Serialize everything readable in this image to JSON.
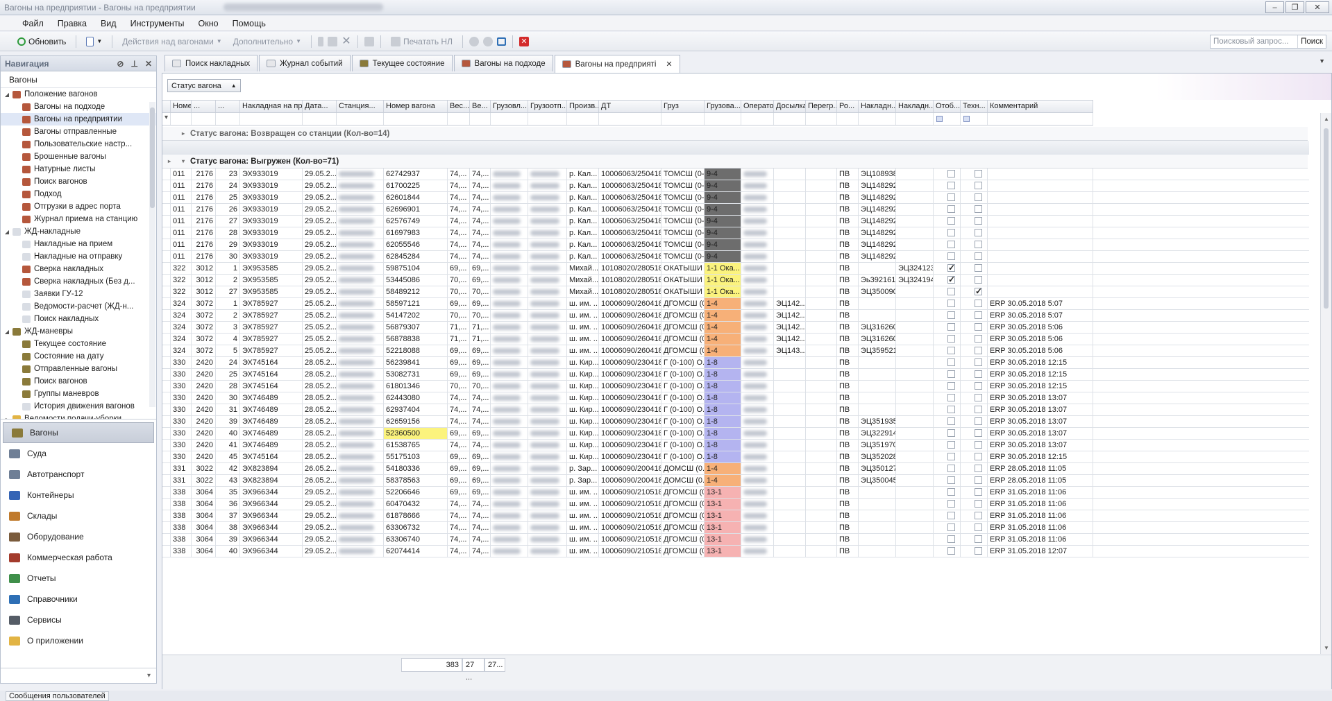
{
  "window": {
    "title": "Вагоны на предприятии - Вагоны на предприятии",
    "controls": [
      "‒",
      "❐",
      "✕"
    ]
  },
  "menu": [
    "Файл",
    "Правка",
    "Вид",
    "Инструменты",
    "Окно",
    "Помощь"
  ],
  "toolbar": {
    "refresh": "Обновить",
    "actions": "Действия над вагонами",
    "more": "Дополнительно",
    "print": "Печатать НЛ",
    "search_placeholder": "Поисковый запрос...",
    "search_button": "Поиск"
  },
  "nav": {
    "title": "Навигация",
    "section": "Вагоны",
    "tree": [
      {
        "label": "Положение вагонов",
        "level": 0,
        "expand": "◢",
        "icon": "#b5573c"
      },
      {
        "label": "Вагоны на подходе",
        "level": 1,
        "icon": "#b5573c"
      },
      {
        "label": "Вагоны на предприятии",
        "level": 1,
        "icon": "#b5573c",
        "selected": true
      },
      {
        "label": "Вагоны отправленные",
        "level": 1,
        "icon": "#b5573c"
      },
      {
        "label": "Пользовательские настр...",
        "level": 1,
        "icon": "#b5573c"
      },
      {
        "label": "Брошенные вагоны",
        "level": 1,
        "icon": "#b5573c"
      },
      {
        "label": "Натурные листы",
        "level": 1,
        "icon": "#b5573c"
      },
      {
        "label": "Поиск вагонов",
        "level": 1,
        "icon": "#b5573c"
      },
      {
        "label": "Подход",
        "level": 1,
        "icon": "#b5573c"
      },
      {
        "label": "Отгрузки в адрес порта",
        "level": 1,
        "icon": "#b5573c"
      },
      {
        "label": "Журнал приема на станцию",
        "level": 1,
        "icon": "#b5573c"
      },
      {
        "label": "ЖД-накладные",
        "level": 0,
        "expand": "◢",
        "icon": "#d9dde4"
      },
      {
        "label": "Накладные на прием",
        "level": 1,
        "icon": "#d9dde4"
      },
      {
        "label": "Накладные на отправку",
        "level": 1,
        "icon": "#d9dde4"
      },
      {
        "label": "Сверка накладных",
        "level": 1,
        "icon": "#b5573c"
      },
      {
        "label": "Сверка накладных (Без д...",
        "level": 1,
        "icon": "#b5573c"
      },
      {
        "label": "Заявки ГУ-12",
        "level": 1,
        "icon": "#d9dde4"
      },
      {
        "label": "Ведомости-расчет (ЖД-н...",
        "level": 1,
        "icon": "#d9dde4"
      },
      {
        "label": "Поиск накладных",
        "level": 1,
        "icon": "#d9dde4"
      },
      {
        "label": "ЖД-маневры",
        "level": 0,
        "expand": "◢",
        "icon": "#8a7a3a"
      },
      {
        "label": "Текущее состояние",
        "level": 1,
        "icon": "#8a7a3a"
      },
      {
        "label": "Состояние на дату",
        "level": 1,
        "icon": "#8a7a3a"
      },
      {
        "label": "Отправленные вагоны",
        "level": 1,
        "icon": "#8a7a3a"
      },
      {
        "label": "Поиск вагонов",
        "level": 1,
        "icon": "#8a7a3a"
      },
      {
        "label": "Группы маневров",
        "level": 1,
        "icon": "#8a7a3a"
      },
      {
        "label": "История движения вагонов",
        "level": 1,
        "icon": "#d9dde4"
      },
      {
        "label": "Ведомости подачи-уборки",
        "level": 0,
        "expand": "▸",
        "icon": "#e2b444"
      }
    ],
    "categories": [
      {
        "label": "Вагоны",
        "icon": "#8a7a3a",
        "selected": true
      },
      {
        "label": "Суда",
        "icon": "#6f7f96"
      },
      {
        "label": "Автотранспорт",
        "icon": "#6f7f96"
      },
      {
        "label": "Контейнеры",
        "icon": "#3564b5"
      },
      {
        "label": "Склады",
        "icon": "#c07a2c"
      },
      {
        "label": "Оборудование",
        "icon": "#7a5b3c"
      },
      {
        "label": "Коммерческая работа",
        "icon": "#a33b2c"
      },
      {
        "label": "Отчеты",
        "icon": "#3f8f4a"
      },
      {
        "label": "Справочники",
        "icon": "#2e6fb5"
      },
      {
        "label": "Сервисы",
        "icon": "#555c66"
      },
      {
        "label": "О приложении",
        "icon": "#e2b444"
      }
    ]
  },
  "tabs": [
    {
      "label": "Поиск накладных",
      "icon": "#e6e7ea"
    },
    {
      "label": "Журнал событий",
      "icon": "#e6e7ea"
    },
    {
      "label": "Текущее состояние",
      "icon": "#8a7a3a"
    },
    {
      "label": "Вагоны на подходе",
      "icon": "#b5573c"
    },
    {
      "label": "Вагоны на предприяті",
      "icon": "#b5573c",
      "active": true
    }
  ],
  "grid": {
    "group_button": "Статус вагона",
    "columns": [
      "Номер...",
      "...",
      "...",
      "Накладная на прием",
      "Дата...",
      "Станция...",
      "Номер вагона",
      "Вес...",
      "Ве...",
      "Грузовл...",
      "Грузоотп...",
      "Произв...",
      "ДТ",
      "Груз",
      "Грузова...",
      "Оператор",
      "Досылка",
      "Перегр...",
      "Ро...",
      "Накладн...",
      "Накладн...",
      "Отоб...",
      "Техн...",
      "Комментарий"
    ],
    "group1": "Статус вагона: Возвращен со станции (Кол-во=14)",
    "group2": "Статус вагона: Выгружен (Кол-во=71)",
    "rows": [
      [
        "011",
        "2176",
        "23",
        "ЭХ933019",
        "29.05.2...",
        "",
        "62742937",
        "74,...",
        "74,...",
        "",
        "",
        "р. Кал...",
        "10006063/250418...",
        "ТОМСШ (0-...",
        "9-4",
        "",
        "",
        "",
        "ПВ",
        "ЭЦ108938",
        "",
        false,
        false,
        ""
      ],
      [
        "011",
        "2176",
        "24",
        "ЭХ933019",
        "29.05.2...",
        "",
        "61700225",
        "74,...",
        "74,...",
        "",
        "",
        "р. Кал...",
        "10006063/250418...",
        "ТОМСШ (0-...",
        "9-4",
        "",
        "",
        "",
        "ПВ",
        "ЭЦ148292",
        "",
        false,
        false,
        ""
      ],
      [
        "011",
        "2176",
        "25",
        "ЭХ933019",
        "29.05.2...",
        "",
        "62601844",
        "74,...",
        "74,...",
        "",
        "",
        "р. Кал...",
        "10006063/250418...",
        "ТОМСШ (0-...",
        "9-4",
        "",
        "",
        "",
        "ПВ",
        "ЭЦ148292",
        "",
        false,
        false,
        ""
      ],
      [
        "011",
        "2176",
        "26",
        "ЭХ933019",
        "29.05.2...",
        "",
        "62696901",
        "74,...",
        "74,...",
        "",
        "",
        "р. Кал...",
        "10006063/250418...",
        "ТОМСШ (0-...",
        "9-4",
        "",
        "",
        "",
        "ПВ",
        "ЭЦ148292",
        "",
        false,
        false,
        ""
      ],
      [
        "011",
        "2176",
        "27",
        "ЭХ933019",
        "29.05.2...",
        "",
        "62576749",
        "74,...",
        "74,...",
        "",
        "",
        "р. Кал...",
        "10006063/250418...",
        "ТОМСШ (0-...",
        "9-4",
        "",
        "",
        "",
        "ПВ",
        "ЭЦ148292",
        "",
        false,
        false,
        ""
      ],
      [
        "011",
        "2176",
        "28",
        "ЭХ933019",
        "29.05.2...",
        "",
        "61697983",
        "74,...",
        "74,...",
        "",
        "",
        "р. Кал...",
        "10006063/250418...",
        "ТОМСШ (0-...",
        "9-4",
        "",
        "",
        "",
        "ПВ",
        "ЭЦ148292",
        "",
        false,
        false,
        ""
      ],
      [
        "011",
        "2176",
        "29",
        "ЭХ933019",
        "29.05.2...",
        "",
        "62055546",
        "74,...",
        "74,...",
        "",
        "",
        "р. Кал...",
        "10006063/250418...",
        "ТОМСШ (0-...",
        "9-4",
        "",
        "",
        "",
        "ПВ",
        "ЭЦ148292",
        "",
        false,
        false,
        ""
      ],
      [
        "011",
        "2176",
        "30",
        "ЭХ933019",
        "29.05.2...",
        "",
        "62845284",
        "74,...",
        "74,...",
        "",
        "",
        "р. Кал...",
        "10006063/250418...",
        "ТОМСШ (0-...",
        "9-4",
        "",
        "",
        "",
        "ПВ",
        "ЭЦ148292",
        "",
        false,
        false,
        ""
      ],
      [
        "322",
        "3012",
        "1",
        "ЭХ953585",
        "29.05.2...",
        "",
        "59875104",
        "69,...",
        "69,...",
        "",
        "",
        "Михай...",
        "10108020/280518...",
        "ОКАТЫШИ ...",
        "1-1 Ока...",
        "",
        "",
        "",
        "ПВ",
        "",
        "ЭЦ324123",
        true,
        false,
        ""
      ],
      [
        "322",
        "3012",
        "2",
        "ЭХ953585",
        "29.05.2...",
        "",
        "53445086",
        "70,...",
        "69,...",
        "",
        "",
        "Михай...",
        "10108020/280518...",
        "ОКАТЫШИ ...",
        "1-1 Ока...",
        "",
        "",
        "",
        "ПВ",
        "Эь392161",
        "ЭЦ324194",
        true,
        false,
        ""
      ],
      [
        "322",
        "3012",
        "27",
        "ЭХ953585",
        "29.05.2...",
        "",
        "58489212",
        "70,...",
        "70,...",
        "",
        "",
        "Михай...",
        "10108020/280518...",
        "ОКАТЫШИ ...",
        "1-1 Ока...",
        "",
        "",
        "",
        "ПВ",
        "ЭЦ350090",
        "",
        false,
        true,
        ""
      ],
      [
        "324",
        "3072",
        "1",
        "ЭХ785927",
        "25.05.2...",
        "",
        "58597121",
        "69,...",
        "69,...",
        "",
        "",
        "ш. им. ...",
        "10006090/260418...",
        "ДГОМСШ (0-...",
        "1-4",
        "",
        "ЭЦ142...",
        "",
        "ПВ",
        "",
        "",
        false,
        false,
        "ERP 30.05.2018 5:07"
      ],
      [
        "324",
        "3072",
        "2",
        "ЭХ785927",
        "25.05.2...",
        "",
        "54147202",
        "70,...",
        "70,...",
        "",
        "",
        "ш. им. ...",
        "10006090/260418...",
        "ДГОМСШ (0-...",
        "1-4",
        "",
        "ЭЦ142...",
        "",
        "ПВ",
        "",
        "",
        false,
        false,
        "ERP 30.05.2018 5:07"
      ],
      [
        "324",
        "3072",
        "3",
        "ЭХ785927",
        "25.05.2...",
        "",
        "56879307",
        "71,...",
        "71,...",
        "",
        "",
        "ш. им. ...",
        "10006090/260418...",
        "ДГОМСШ (0-...",
        "1-4",
        "",
        "ЭЦ142...",
        "",
        "ПВ",
        "ЭЦ316260",
        "",
        false,
        false,
        "ERP 30.05.2018 5:06"
      ],
      [
        "324",
        "3072",
        "4",
        "ЭХ785927",
        "25.05.2...",
        "",
        "56878838",
        "71,...",
        "71,...",
        "",
        "",
        "ш. им. ...",
        "10006090/260418...",
        "ДГОМСШ (0-...",
        "1-4",
        "",
        "ЭЦ142...",
        "",
        "ПВ",
        "ЭЦ316260",
        "",
        false,
        false,
        "ERP 30.05.2018 5:06"
      ],
      [
        "324",
        "3072",
        "5",
        "ЭХ785927",
        "25.05.2...",
        "",
        "52218088",
        "69,...",
        "69,...",
        "",
        "",
        "ш. им. ...",
        "10006090/260418...",
        "ДГОМСШ (0-...",
        "1-4",
        "",
        "ЭЦ143...",
        "",
        "ПВ",
        "ЭЦ359521",
        "",
        false,
        false,
        "ERP 30.05.2018 5:06"
      ],
      [
        "330",
        "2420",
        "24",
        "ЭХ745164",
        "28.05.2...",
        "",
        "56239841",
        "69,...",
        "69,...",
        "",
        "",
        "ш. Кир...",
        "10006090/230418...",
        "Г (0-100) О...",
        "1-8",
        "",
        "",
        "",
        "ПВ",
        "",
        "",
        false,
        false,
        "ERP 30.05.2018 12:15"
      ],
      [
        "330",
        "2420",
        "25",
        "ЭХ745164",
        "28.05.2...",
        "",
        "53082731",
        "69,...",
        "69,...",
        "",
        "",
        "ш. Кир...",
        "10006090/230418...",
        "Г (0-100) О...",
        "1-8",
        "",
        "",
        "",
        "ПВ",
        "",
        "",
        false,
        false,
        "ERP 30.05.2018 12:15"
      ],
      [
        "330",
        "2420",
        "28",
        "ЭХ745164",
        "28.05.2...",
        "",
        "61801346",
        "70,...",
        "70,...",
        "",
        "",
        "ш. Кир...",
        "10006090/230418...",
        "Г (0-100) О...",
        "1-8",
        "",
        "",
        "",
        "ПВ",
        "",
        "",
        false,
        false,
        "ERP 30.05.2018 12:15"
      ],
      [
        "330",
        "2420",
        "30",
        "ЭХ746489",
        "28.05.2...",
        "",
        "62443080",
        "74,...",
        "74,...",
        "",
        "",
        "ш. Кир...",
        "10006090/230418...",
        "Г (0-100) О...",
        "1-8",
        "",
        "",
        "",
        "ПВ",
        "",
        "",
        false,
        false,
        "ERP 30.05.2018 13:07"
      ],
      [
        "330",
        "2420",
        "31",
        "ЭХ746489",
        "28.05.2...",
        "",
        "62937404",
        "74,...",
        "74,...",
        "",
        "",
        "ш. Кир...",
        "10006090/230418...",
        "Г (0-100) О...",
        "1-8",
        "",
        "",
        "",
        "ПВ",
        "",
        "",
        false,
        false,
        "ERP 30.05.2018 13:07"
      ],
      [
        "330",
        "2420",
        "39",
        "ЭХ746489",
        "28.05.2...",
        "",
        "62659156",
        "74,...",
        "74,...",
        "",
        "",
        "ш. Кир...",
        "10006090/230418...",
        "Г (0-100) О...",
        "1-8",
        "",
        "",
        "",
        "ПВ",
        "ЭЦ351935",
        "",
        false,
        false,
        "ERP 30.05.2018 13:07"
      ],
      [
        "330",
        "2420",
        "40",
        "ЭХ746489",
        "28.05.2...",
        "",
        "52360500",
        "69,...",
        "69,...",
        "",
        "",
        "ш. Кир...",
        "10006090/230418...",
        "Г (0-100) О...",
        "1-8",
        "",
        "",
        "",
        "ПВ",
        "ЭЦ322914",
        "",
        false,
        false,
        "ERP 30.05.2018 13:07"
      ],
      [
        "330",
        "2420",
        "41",
        "ЭХ746489",
        "28.05.2...",
        "",
        "61538765",
        "74,...",
        "74,...",
        "",
        "",
        "ш. Кир...",
        "10006090/230418...",
        "Г (0-100) О...",
        "1-8",
        "",
        "",
        "",
        "ПВ",
        "ЭЦ351970",
        "",
        false,
        false,
        "ERP 30.05.2018 13:07"
      ],
      [
        "330",
        "2420",
        "45",
        "ЭХ745164",
        "28.05.2...",
        "",
        "55175103",
        "69,...",
        "69,...",
        "",
        "",
        "ш. Кир...",
        "10006090/230418...",
        "Г (0-100) О...",
        "1-8",
        "",
        "",
        "",
        "ПВ",
        "ЭЦ352028",
        "",
        false,
        false,
        "ERP 30.05.2018 12:15"
      ],
      [
        "331",
        "3022",
        "42",
        "ЭХ823894",
        "26.05.2...",
        "",
        "54180336",
        "69,...",
        "69,...",
        "",
        "",
        "р. Зар...",
        "10006090/200418...",
        "ДОМСШ (0...",
        "1-4",
        "",
        "",
        "",
        "ПВ",
        "ЭЦ350127",
        "",
        false,
        false,
        "ERP 28.05.2018 11:05"
      ],
      [
        "331",
        "3022",
        "43",
        "ЭХ823894",
        "26.05.2...",
        "",
        "58378563",
        "69,...",
        "69,...",
        "",
        "",
        "р. Зар...",
        "10006090/200418...",
        "ДОМСШ (0...",
        "1-4",
        "",
        "",
        "",
        "ПВ",
        "ЭЦ350045",
        "",
        false,
        false,
        "ERP 28.05.2018 11:05"
      ],
      [
        "338",
        "3064",
        "35",
        "ЭХ966344",
        "29.05.2...",
        "",
        "52206646",
        "69,...",
        "69,...",
        "",
        "",
        "ш. им. ...",
        "10006090/210518...",
        "ДГОМСШ (0-...",
        "13-1",
        "",
        "",
        "",
        "ПВ",
        "",
        "",
        false,
        false,
        "ERP 31.05.2018 11:06"
      ],
      [
        "338",
        "3064",
        "36",
        "ЭХ966344",
        "29.05.2...",
        "",
        "60470432",
        "74,...",
        "74,...",
        "",
        "",
        "ш. им. ...",
        "10006090/210518...",
        "ДГОМСШ (0-...",
        "13-1",
        "",
        "",
        "",
        "ПВ",
        "",
        "",
        false,
        false,
        "ERP 31.05.2018 11:06"
      ],
      [
        "338",
        "3064",
        "37",
        "ЭХ966344",
        "29.05.2...",
        "",
        "61878666",
        "74,...",
        "74,...",
        "",
        "",
        "ш. им. ...",
        "10006090/210518...",
        "ДГОМСШ (0-...",
        "13-1",
        "",
        "",
        "",
        "ПВ",
        "",
        "",
        false,
        false,
        "ERP 31.05.2018 11:06"
      ],
      [
        "338",
        "3064",
        "38",
        "ЭХ966344",
        "29.05.2...",
        "",
        "63306732",
        "74,...",
        "74,...",
        "",
        "",
        "ш. им. ...",
        "10006090/210518...",
        "ДГОМСШ (0-...",
        "13-1",
        "",
        "",
        "",
        "ПВ",
        "",
        "",
        false,
        false,
        "ERP 31.05.2018 11:06"
      ],
      [
        "338",
        "3064",
        "39",
        "ЭХ966344",
        "29.05.2...",
        "",
        "63306740",
        "74,...",
        "74,...",
        "",
        "",
        "ш. им. ...",
        "10006090/210518...",
        "ДГОМСШ (0-...",
        "13-1",
        "",
        "",
        "",
        "ПВ",
        "",
        "",
        false,
        false,
        "ERP 31.05.2018 11:06"
      ],
      [
        "338",
        "3064",
        "40",
        "ЭХ966344",
        "29.05.2...",
        "",
        "62074414",
        "74,...",
        "74,...",
        "",
        "",
        "ш. им. ...",
        "10006090/210518...",
        "ДГОМСШ (0-...",
        "13-1",
        "",
        "",
        "",
        "ПВ",
        "",
        "",
        false,
        false,
        "ERP 31.05.2018 12:07"
      ]
    ],
    "footer": {
      "count": "383",
      "sum1": "27 ...",
      "sum2": "27..."
    }
  },
  "cargo_colors": {
    "9-4": "#6d6d6d",
    "1-1 Ока...": "#fbf37e",
    "1-4": "#f7b078",
    "1-8": "#b4b4f0",
    "13-1": "#f6b2b2"
  },
  "highlight_wagon": "52360500",
  "highlight_color": "#fbf37e",
  "statusbar": "Сообщения пользователей"
}
